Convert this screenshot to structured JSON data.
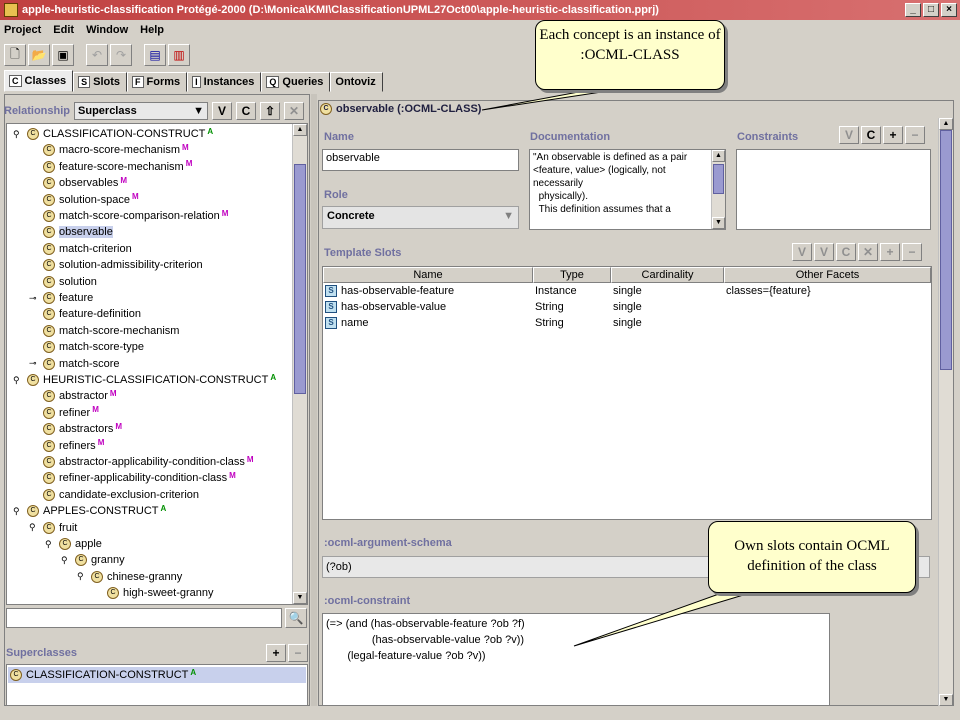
{
  "window": {
    "title": "apple-heuristic-classification  Protégé-2000    (D:\\Monica\\KMI\\ClassificationUPML27Oct00\\apple-heuristic-classification.pprj)",
    "buttons": [
      "_",
      "□",
      "×"
    ]
  },
  "menu": [
    "Project",
    "Edit",
    "Window",
    "Help"
  ],
  "tabs": [
    {
      "label": "Classes",
      "icon": "C",
      "active": true
    },
    {
      "label": "Slots",
      "icon": "S"
    },
    {
      "label": "Forms",
      "icon": "F"
    },
    {
      "label": "Instances",
      "icon": "I"
    },
    {
      "label": "Queries",
      "icon": "Q"
    },
    {
      "label": "Ontoviz",
      "icon": ""
    }
  ],
  "left": {
    "relationship_label": "Relationship",
    "relationship_value": "Superclass",
    "tree": [
      {
        "label": "CLASSIFICATION-CONSTRUCT",
        "badge": "A",
        "depth": 0,
        "exp": "o"
      },
      {
        "label": "macro-score-mechanism",
        "badge": "M",
        "depth": 1
      },
      {
        "label": "feature-score-mechanism",
        "badge": "M",
        "depth": 1
      },
      {
        "label": "observables",
        "badge": "M",
        "depth": 1
      },
      {
        "label": "solution-space",
        "badge": "M",
        "depth": 1
      },
      {
        "label": "match-score-comparison-relation",
        "badge": "M",
        "depth": 1
      },
      {
        "label": "observable",
        "badge": "",
        "depth": 1,
        "selected": true
      },
      {
        "label": "match-criterion",
        "badge": "",
        "depth": 1
      },
      {
        "label": "solution-admissibility-criterion",
        "badge": "",
        "depth": 1
      },
      {
        "label": "solution",
        "badge": "",
        "depth": 1
      },
      {
        "label": "feature",
        "badge": "",
        "depth": 1,
        "exp": "-"
      },
      {
        "label": "feature-definition",
        "badge": "",
        "depth": 1
      },
      {
        "label": "match-score-mechanism",
        "badge": "",
        "depth": 1
      },
      {
        "label": "match-score-type",
        "badge": "",
        "depth": 1
      },
      {
        "label": "match-score",
        "badge": "",
        "depth": 1,
        "exp": "-"
      },
      {
        "label": "HEURISTIC-CLASSIFICATION-CONSTRUCT",
        "badge": "A",
        "depth": 0,
        "exp": "o"
      },
      {
        "label": "abstractor",
        "badge": "M",
        "depth": 1
      },
      {
        "label": "refiner",
        "badge": "M",
        "depth": 1
      },
      {
        "label": "abstractors",
        "badge": "M",
        "depth": 1
      },
      {
        "label": "refiners",
        "badge": "M",
        "depth": 1
      },
      {
        "label": "abstractor-applicability-condition-class",
        "badge": "M",
        "depth": 1
      },
      {
        "label": "refiner-applicability-condition-class",
        "badge": "M",
        "depth": 1
      },
      {
        "label": "candidate-exclusion-criterion",
        "badge": "",
        "depth": 1
      },
      {
        "label": "APPLES-CONSTRUCT",
        "badge": "A",
        "depth": 0,
        "exp": "o"
      },
      {
        "label": "fruit",
        "badge": "",
        "depth": 1,
        "exp": "o"
      },
      {
        "label": "apple",
        "badge": "",
        "depth": 2,
        "exp": "o"
      },
      {
        "label": "granny",
        "badge": "",
        "depth": 3,
        "exp": "o"
      },
      {
        "label": "chinese-granny",
        "badge": "",
        "depth": 4,
        "exp": "o"
      },
      {
        "label": "high-sweet-granny",
        "badge": "",
        "depth": 5
      }
    ],
    "superclasses_label": "Superclasses",
    "superclasses": [
      {
        "label": "CLASSIFICATION-CONSTRUCT",
        "badge": "A"
      }
    ]
  },
  "right": {
    "class_header": "observable  (:OCML-CLASS)",
    "name_label": "Name",
    "name_value": "observable",
    "doc_label": "Documentation",
    "doc_value": "\"An observable is defined as a pair <feature, value> (logically, not necessarily\n  physically).\n  This definition assumes that a",
    "constraints_label": "Constraints",
    "role_label": "Role",
    "role_value": "Concrete",
    "template_label": "Template Slots",
    "columns": [
      "Name",
      "Type",
      "Cardinality",
      "Other Facets"
    ],
    "slots": [
      {
        "name": "has-observable-feature",
        "type": "Instance",
        "card": "single",
        "facets": "classes={feature}"
      },
      {
        "name": "has-observable-value",
        "type": "String",
        "card": "single",
        "facets": ""
      },
      {
        "name": "name",
        "type": "String",
        "card": "single",
        "facets": ""
      }
    ],
    "arg_label": ":ocml-argument-schema",
    "arg_value": "(?ob)",
    "constraint_label": ":ocml-constraint",
    "constraint_value": "(=> (and (has-observable-feature ?ob ?f)\n               (has-observable-value ?ob ?v))\n       (legal-feature-value ?ob ?v))"
  },
  "callouts": {
    "top": "Each concept is an instance of :OCML-CLASS",
    "bottom": "Own slots contain OCML definition of the class"
  },
  "colors": {
    "title_bar": "#c04040",
    "selection": "#c8d0ec",
    "badge_M": "#c000c0",
    "badge_A": "#009000",
    "callout_bg": "#ffffcc"
  }
}
